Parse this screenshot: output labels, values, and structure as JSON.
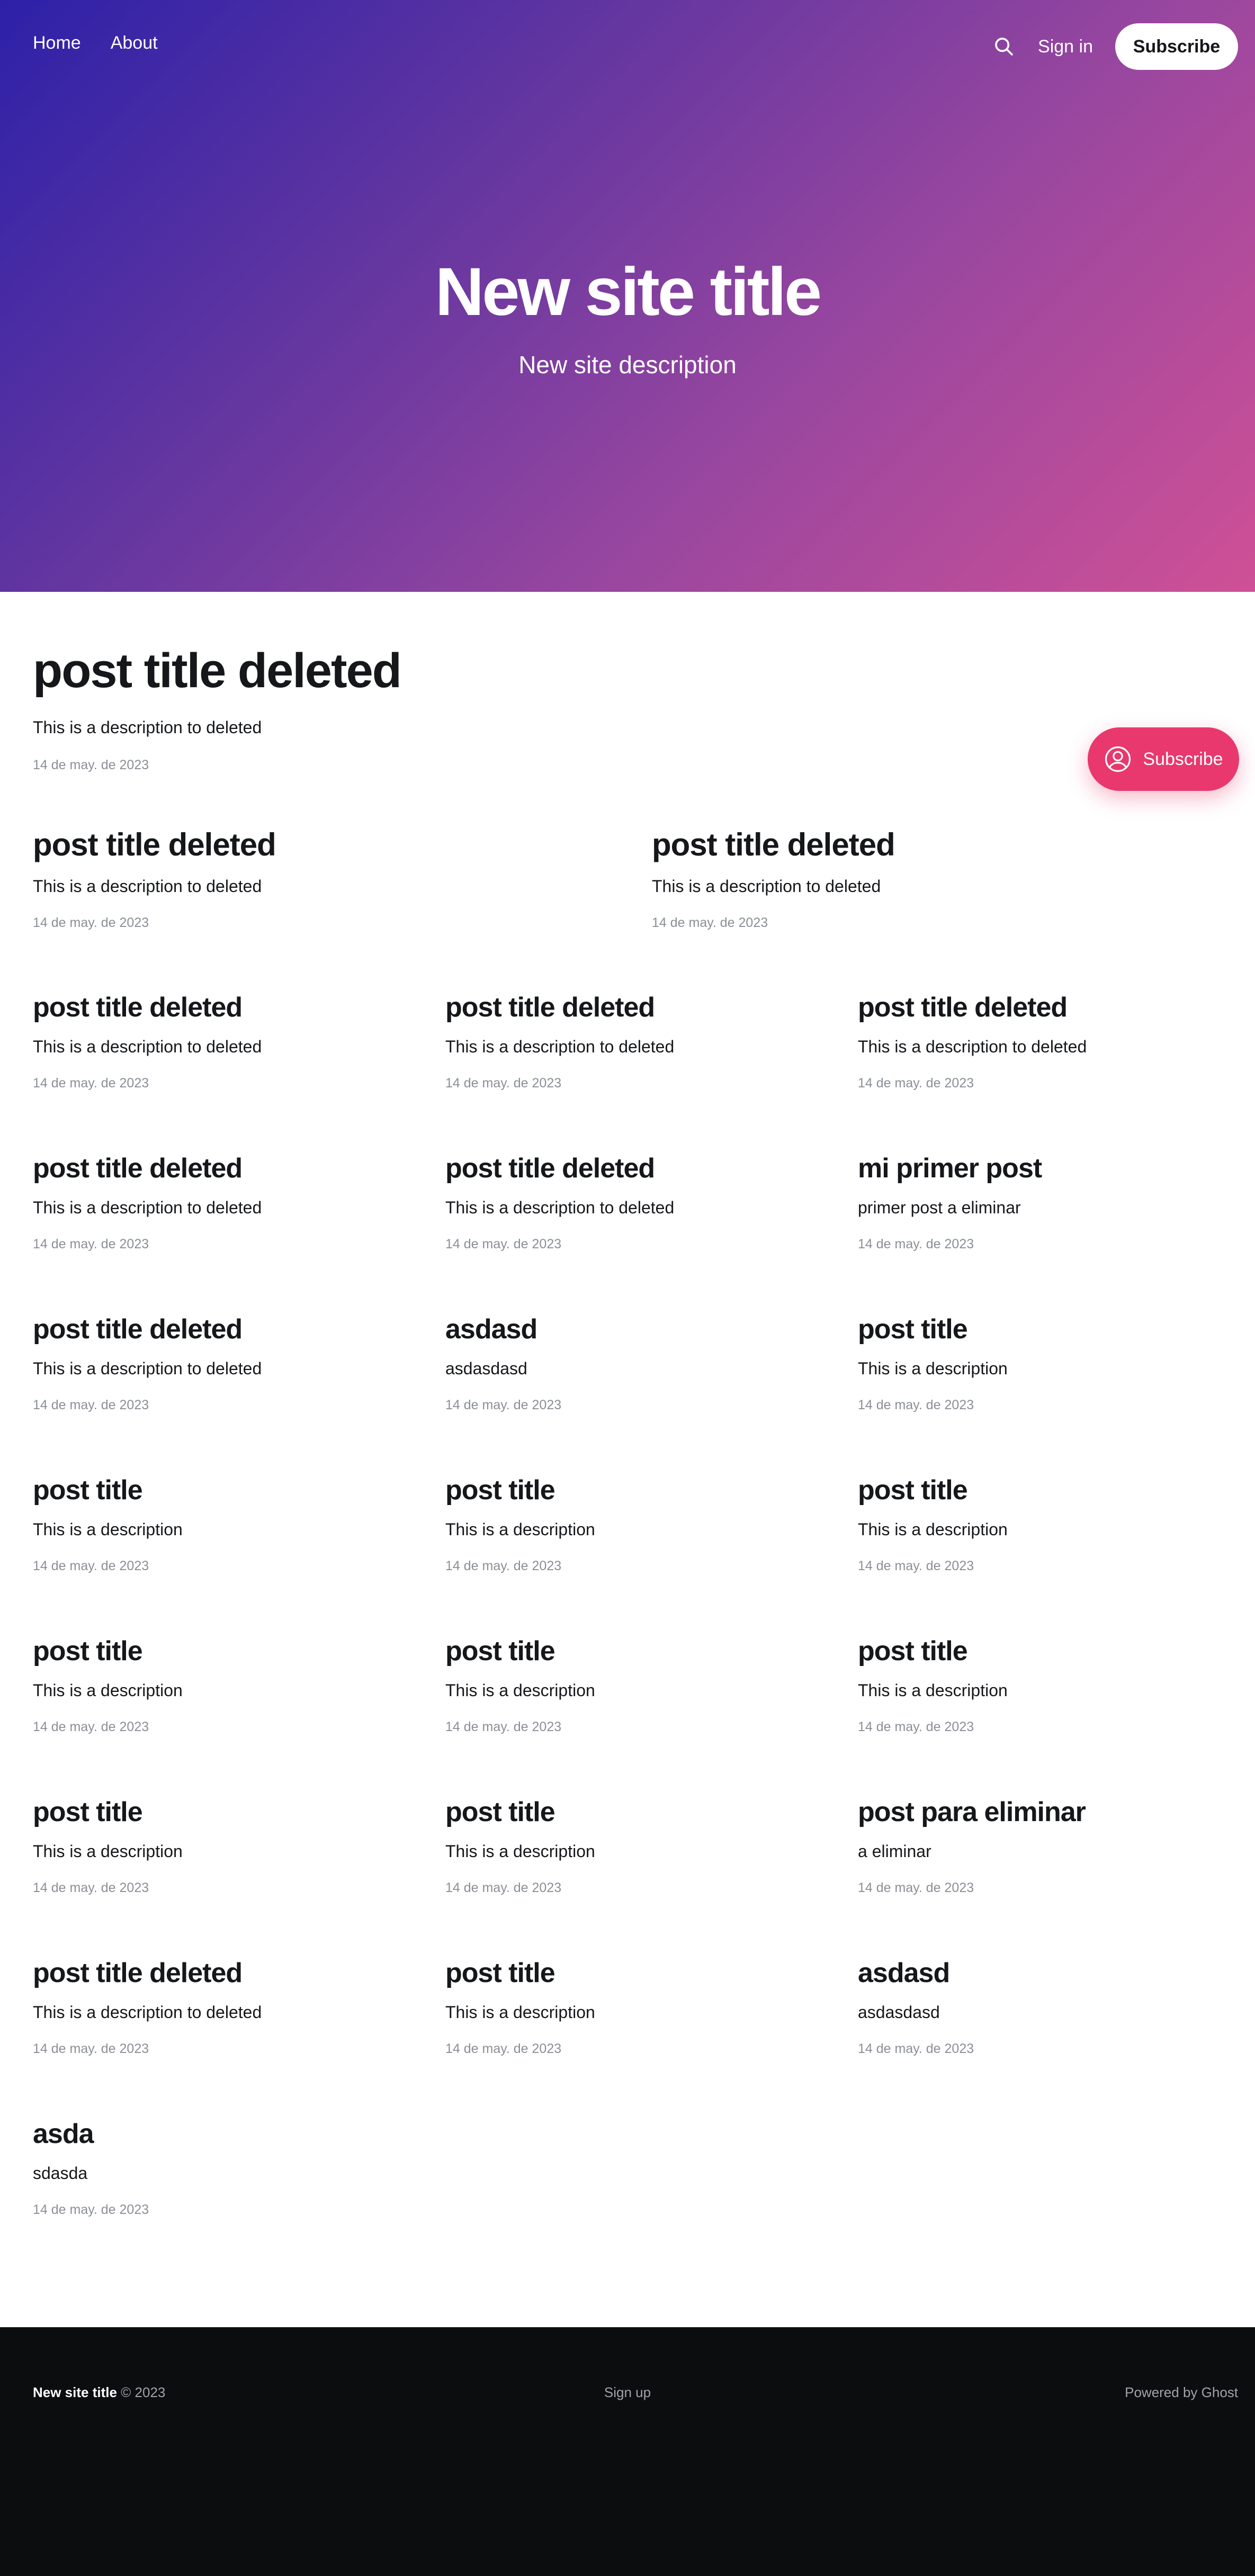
{
  "nav": {
    "links": [
      "Home",
      "About"
    ],
    "signin_label": "Sign in",
    "subscribe_label": "Subscribe"
  },
  "hero": {
    "title": "New site title",
    "description": "New site description"
  },
  "posts": [
    {
      "title": "post title deleted",
      "description": "This is a description to deleted",
      "date": "14 de may. de 2023"
    },
    {
      "title": "post title deleted",
      "description": "This is a description to deleted",
      "date": "14 de may. de 2023"
    },
    {
      "title": "post title deleted",
      "description": "This is a description to deleted",
      "date": "14 de may. de 2023"
    },
    {
      "title": "post title deleted",
      "description": "This is a description to deleted",
      "date": "14 de may. de 2023"
    },
    {
      "title": "post title deleted",
      "description": "This is a description to deleted",
      "date": "14 de may. de 2023"
    },
    {
      "title": "post title deleted",
      "description": "This is a description to deleted",
      "date": "14 de may. de 2023"
    },
    {
      "title": "post title deleted",
      "description": "This is a description to deleted",
      "date": "14 de may. de 2023"
    },
    {
      "title": "post title deleted",
      "description": "This is a description to deleted",
      "date": "14 de may. de 2023"
    },
    {
      "title": "mi primer post",
      "description": "primer post a eliminar",
      "date": "14 de may. de 2023"
    },
    {
      "title": "post title deleted",
      "description": "This is a description to deleted",
      "date": "14 de may. de 2023"
    },
    {
      "title": "asdasd",
      "description": "asdasdasd",
      "date": "14 de may. de 2023"
    },
    {
      "title": "post title",
      "description": "This is a description",
      "date": "14 de may. de 2023"
    },
    {
      "title": "post title",
      "description": "This is a description",
      "date": "14 de may. de 2023"
    },
    {
      "title": "post title",
      "description": "This is a description",
      "date": "14 de may. de 2023"
    },
    {
      "title": "post title",
      "description": "This is a description",
      "date": "14 de may. de 2023"
    },
    {
      "title": "post title",
      "description": "This is a description",
      "date": "14 de may. de 2023"
    },
    {
      "title": "post title",
      "description": "This is a description",
      "date": "14 de may. de 2023"
    },
    {
      "title": "post title",
      "description": "This is a description",
      "date": "14 de may. de 2023"
    },
    {
      "title": "post title",
      "description": "This is a description",
      "date": "14 de may. de 2023"
    },
    {
      "title": "post title",
      "description": "This is a description",
      "date": "14 de may. de 2023"
    },
    {
      "title": "post para eliminar",
      "description": "a eliminar",
      "date": "14 de may. de 2023"
    },
    {
      "title": "post title deleted",
      "description": "This is a description to deleted",
      "date": "14 de may. de 2023"
    },
    {
      "title": "post title",
      "description": "This is a description",
      "date": "14 de may. de 2023"
    },
    {
      "title": "asdasd",
      "description": "asdasdasd",
      "date": "14 de may. de 2023"
    },
    {
      "title": "asda",
      "description": "sdasda",
      "date": "14 de may. de 2023"
    }
  ],
  "floating_subscribe": {
    "label": "Subscribe",
    "icon": "user-circle-icon"
  },
  "footer": {
    "site_title": "New site title",
    "copyright": "© 2023",
    "signup_label": "Sign up",
    "powered_label": "Powered by Ghost"
  },
  "colors": {
    "hero_gradient_start": "#2d21a8",
    "hero_gradient_end": "#cf5096",
    "accent": "#e8386d",
    "footer_bg": "#0c0d0f"
  }
}
